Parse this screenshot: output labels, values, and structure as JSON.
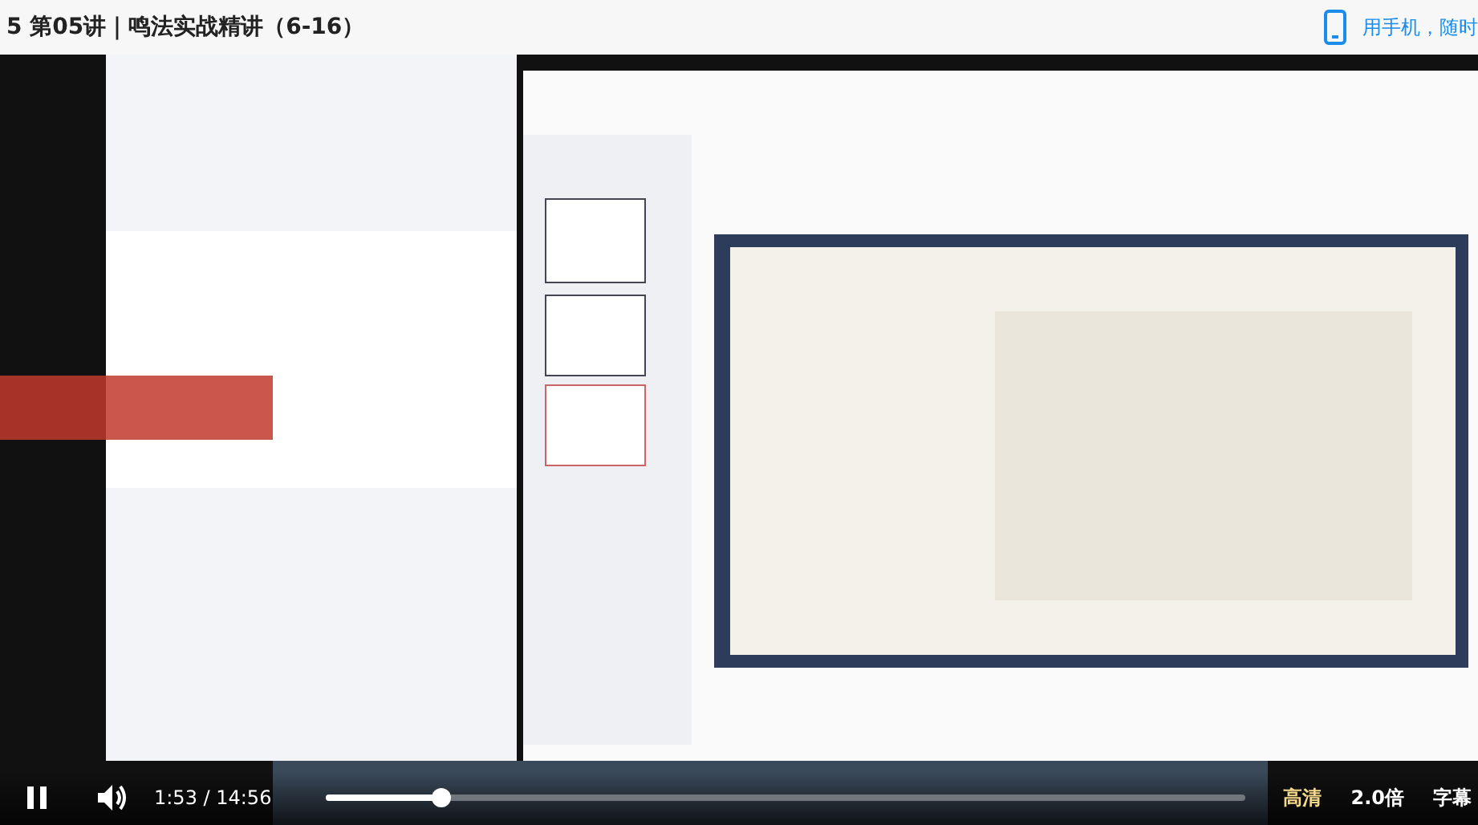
{
  "title": "5 第05讲｜鸣法实战精讲（6-16）",
  "mobile_link": "用手机，随时",
  "controls": {
    "playing": true,
    "time": "1:53 / 14:56",
    "level": 0.126,
    "quality": "高清",
    "speed": "2.0倍",
    "subtitles": "字幕"
  }
}
